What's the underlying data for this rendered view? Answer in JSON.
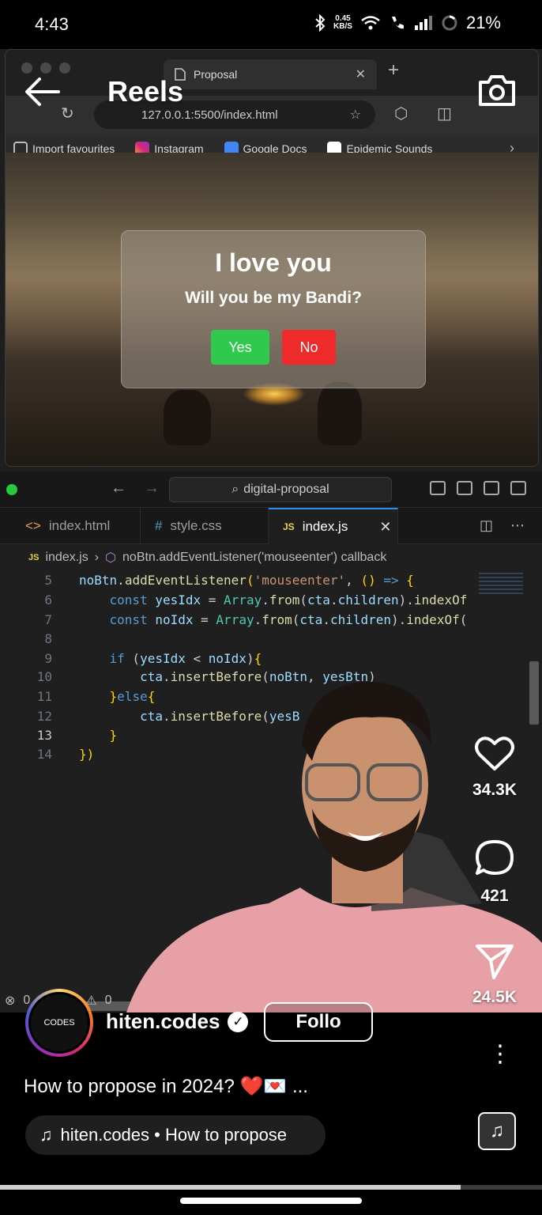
{
  "status_bar": {
    "time": "4:43",
    "data_speed_value": "0.45",
    "data_speed_unit": "KB/S",
    "battery": "21%",
    "icons": [
      "bluetooth-icon",
      "wifi-icon",
      "wifi-call-icon",
      "signal-icon",
      "battery-icon"
    ]
  },
  "reels": {
    "title": "Reels"
  },
  "browser": {
    "tab_title": "Proposal",
    "url": "127.0.0.1:5500/index.html",
    "favourites": [
      "Import favourites",
      "Instagram",
      "Google Docs",
      "Epidemic Sounds"
    ],
    "dialog": {
      "heading": "I love you",
      "question": "Will you be my Bandi?",
      "yes_label": "Yes",
      "no_label": "No"
    }
  },
  "editor": {
    "search": "digital-proposal",
    "tabs": [
      {
        "label": "index.html",
        "icon": "<>"
      },
      {
        "label": "style.css",
        "icon": "#"
      },
      {
        "label": "index.js",
        "icon": "JS"
      }
    ],
    "breadcrumb_file": "index.js",
    "breadcrumb_symbol": "noBtn.addEventListener('mouseenter') callback",
    "line_numbers": [
      "5",
      "6",
      "7",
      "8",
      "9",
      "10",
      "11",
      "12",
      "13",
      "14"
    ],
    "status_errors": "0",
    "status_warnings": "0"
  },
  "engagement": {
    "likes": "34.3K",
    "comments": "421",
    "shares": "24.5K"
  },
  "post": {
    "username": "hiten.codes",
    "follow_label": "Follo",
    "caption": "How to propose in 2024? ❤️💌 ...",
    "audio": "hiten.codes • How to propose",
    "avatar_text": "CODES",
    "progress": 0.85
  },
  "colors": {
    "yes_button": "#2fc94e",
    "no_button": "#ee2a2a",
    "vscode_bg": "#1f1f1f",
    "accent_blue": "#2d8cf0"
  }
}
